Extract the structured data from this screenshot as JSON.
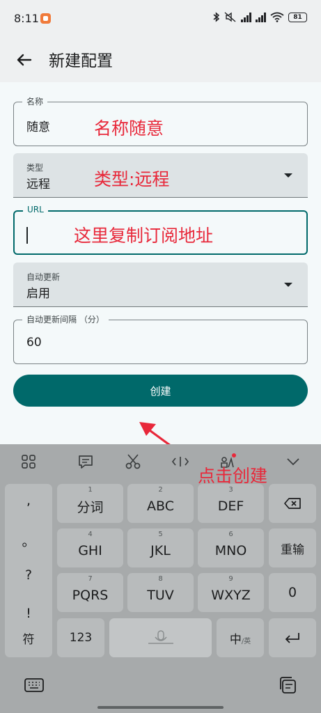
{
  "status_bar": {
    "time": "8:11",
    "battery": "81"
  },
  "app_bar": {
    "title": "新建配置"
  },
  "form": {
    "name": {
      "label": "名称",
      "value": "随意",
      "annotation": "名称随意"
    },
    "type": {
      "label": "类型",
      "value": "远程",
      "annotation": "类型:远程"
    },
    "url": {
      "label": "URL",
      "value": "",
      "annotation": "这里复制订阅地址"
    },
    "auto_update": {
      "label": "自动更新",
      "value": "启用"
    },
    "interval": {
      "label": "自动更新间隔 （分）",
      "value": "60"
    },
    "create_label": "创建",
    "create_annotation": "点击创建"
  },
  "colors": {
    "accent": "#00696a",
    "annotation": "#e8283a"
  },
  "keyboard": {
    "punct": [
      ",",
      "。",
      "?",
      "!"
    ],
    "rows": [
      [
        {
          "sub": "1",
          "label": "分词"
        },
        {
          "sub": "2",
          "label": "ABC"
        },
        {
          "sub": "3",
          "label": "DEF"
        }
      ],
      [
        {
          "sub": "4",
          "label": "GHI"
        },
        {
          "sub": "5",
          "label": "JKL"
        },
        {
          "sub": "6",
          "label": "MNO"
        }
      ],
      [
        {
          "sub": "7",
          "label": "PQRS"
        },
        {
          "sub": "8",
          "label": "TUV"
        },
        {
          "sub": "9",
          "label": "WXYZ"
        }
      ]
    ],
    "retype": "重输",
    "zero": "0",
    "symbol": "符",
    "num": "123",
    "lang_main": "中",
    "lang_sub": "/英"
  }
}
